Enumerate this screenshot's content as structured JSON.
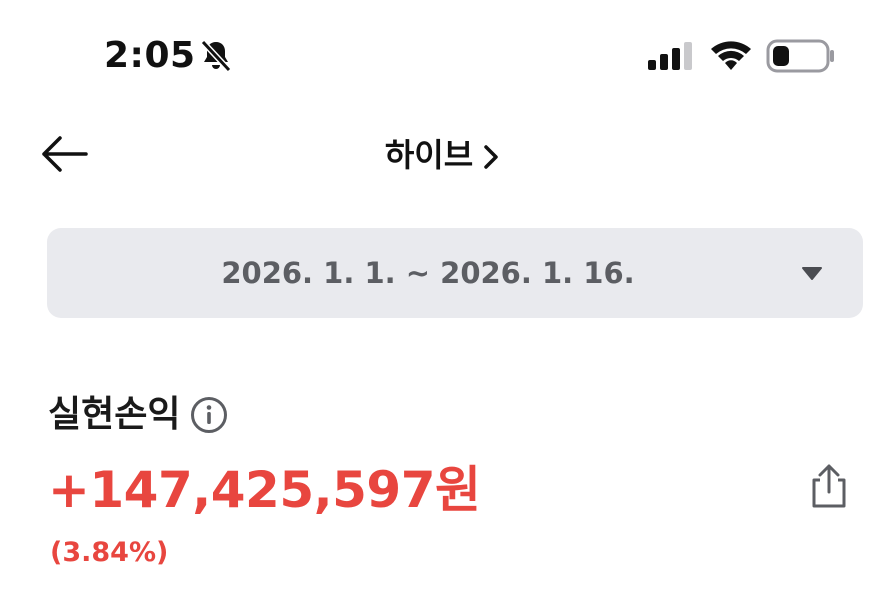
{
  "status_bar": {
    "time": "2:05",
    "icons": [
      "bell-slash-icon",
      "signal-icon",
      "wifi-icon",
      "battery-icon"
    ]
  },
  "header": {
    "title": "하이브",
    "back_icon": "arrow-left-icon",
    "title_icon": "chevron-right-icon"
  },
  "date_range": {
    "label": "2026. 1. 1. ~ 2026. 1. 16.",
    "icon": "caret-down-icon"
  },
  "profit": {
    "label": "실현손익",
    "info_icon": "info-icon",
    "amount": "+147,425,597원",
    "percent": "(3.84%)",
    "share_icon": "share-icon"
  },
  "colors": {
    "positive": "#e8463f",
    "selector_bg": "#e9eaee",
    "selector_text": "#5c5e63"
  }
}
